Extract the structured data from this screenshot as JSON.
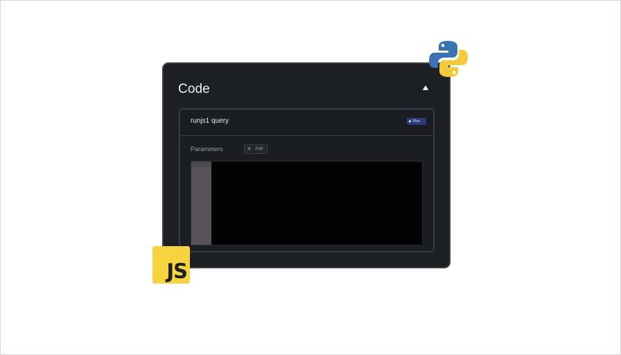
{
  "card": {
    "title": "Code",
    "collapse_icon": "triangle-up-icon"
  },
  "query": {
    "name": "runjs1 query",
    "run_label": "Run",
    "run_icon": "play-icon"
  },
  "parameters": {
    "label": "Parameters",
    "add_label": "Add",
    "add_icon": "plus-icon"
  },
  "editor": {
    "content": ""
  },
  "logos": {
    "python": "python-logo",
    "javascript_text": "JS"
  },
  "colors": {
    "card_bg": "#1e1f24",
    "run_button": "#2e3b7a",
    "js_yellow": "#f4d43f",
    "python_blue": "#3a74b0",
    "python_yellow": "#f6c93a"
  }
}
